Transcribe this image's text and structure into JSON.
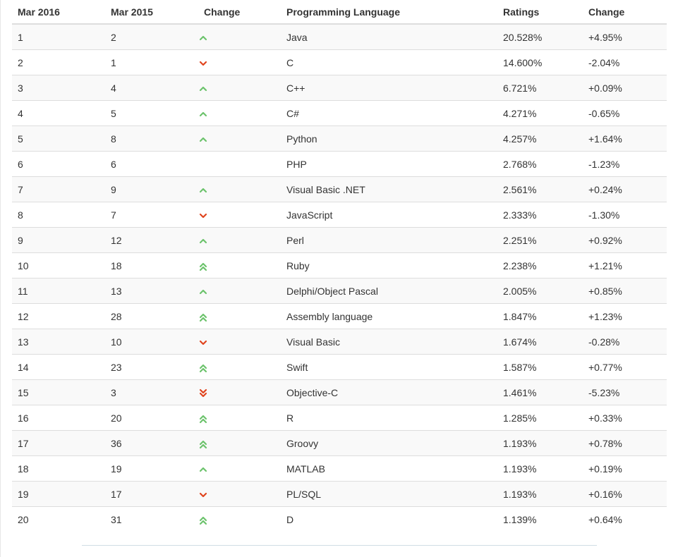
{
  "headers": [
    "Mar 2016",
    "Mar 2015",
    "Change",
    "Programming Language",
    "Ratings",
    "Change"
  ],
  "colors": {
    "up": "#6cc36c",
    "down": "#e0441e"
  },
  "rows": [
    {
      "rank": "1",
      "prev": "2",
      "trend": "up",
      "language": "Java",
      "rating": "20.528%",
      "change": "+4.95%"
    },
    {
      "rank": "2",
      "prev": "1",
      "trend": "down",
      "language": "C",
      "rating": "14.600%",
      "change": "-2.04%"
    },
    {
      "rank": "3",
      "prev": "4",
      "trend": "up",
      "language": "C++",
      "rating": "6.721%",
      "change": "+0.09%"
    },
    {
      "rank": "4",
      "prev": "5",
      "trend": "up",
      "language": "C#",
      "rating": "4.271%",
      "change": "-0.65%"
    },
    {
      "rank": "5",
      "prev": "8",
      "trend": "up",
      "language": "Python",
      "rating": "4.257%",
      "change": "+1.64%"
    },
    {
      "rank": "6",
      "prev": "6",
      "trend": "none",
      "language": "PHP",
      "rating": "2.768%",
      "change": "-1.23%"
    },
    {
      "rank": "7",
      "prev": "9",
      "trend": "up",
      "language": "Visual Basic .NET",
      "rating": "2.561%",
      "change": "+0.24%"
    },
    {
      "rank": "8",
      "prev": "7",
      "trend": "down",
      "language": "JavaScript",
      "rating": "2.333%",
      "change": "-1.30%"
    },
    {
      "rank": "9",
      "prev": "12",
      "trend": "up",
      "language": "Perl",
      "rating": "2.251%",
      "change": "+0.92%"
    },
    {
      "rank": "10",
      "prev": "18",
      "trend": "double-up",
      "language": "Ruby",
      "rating": "2.238%",
      "change": "+1.21%"
    },
    {
      "rank": "11",
      "prev": "13",
      "trend": "up",
      "language": "Delphi/Object Pascal",
      "rating": "2.005%",
      "change": "+0.85%"
    },
    {
      "rank": "12",
      "prev": "28",
      "trend": "double-up",
      "language": "Assembly language",
      "rating": "1.847%",
      "change": "+1.23%"
    },
    {
      "rank": "13",
      "prev": "10",
      "trend": "down",
      "language": "Visual Basic",
      "rating": "1.674%",
      "change": "-0.28%"
    },
    {
      "rank": "14",
      "prev": "23",
      "trend": "double-up",
      "language": "Swift",
      "rating": "1.587%",
      "change": "+0.77%"
    },
    {
      "rank": "15",
      "prev": "3",
      "trend": "double-down",
      "language": "Objective-C",
      "rating": "1.461%",
      "change": "-5.23%"
    },
    {
      "rank": "16",
      "prev": "20",
      "trend": "double-up",
      "language": "R",
      "rating": "1.285%",
      "change": "+0.33%"
    },
    {
      "rank": "17",
      "prev": "36",
      "trend": "double-up",
      "language": "Groovy",
      "rating": "1.193%",
      "change": "+0.78%"
    },
    {
      "rank": "18",
      "prev": "19",
      "trend": "up",
      "language": "MATLAB",
      "rating": "1.193%",
      "change": "+0.19%"
    },
    {
      "rank": "19",
      "prev": "17",
      "trend": "down",
      "language": "PL/SQL",
      "rating": "1.193%",
      "change": "+0.16%"
    },
    {
      "rank": "20",
      "prev": "31",
      "trend": "double-up",
      "language": "D",
      "rating": "1.139%",
      "change": "+0.64%"
    }
  ]
}
